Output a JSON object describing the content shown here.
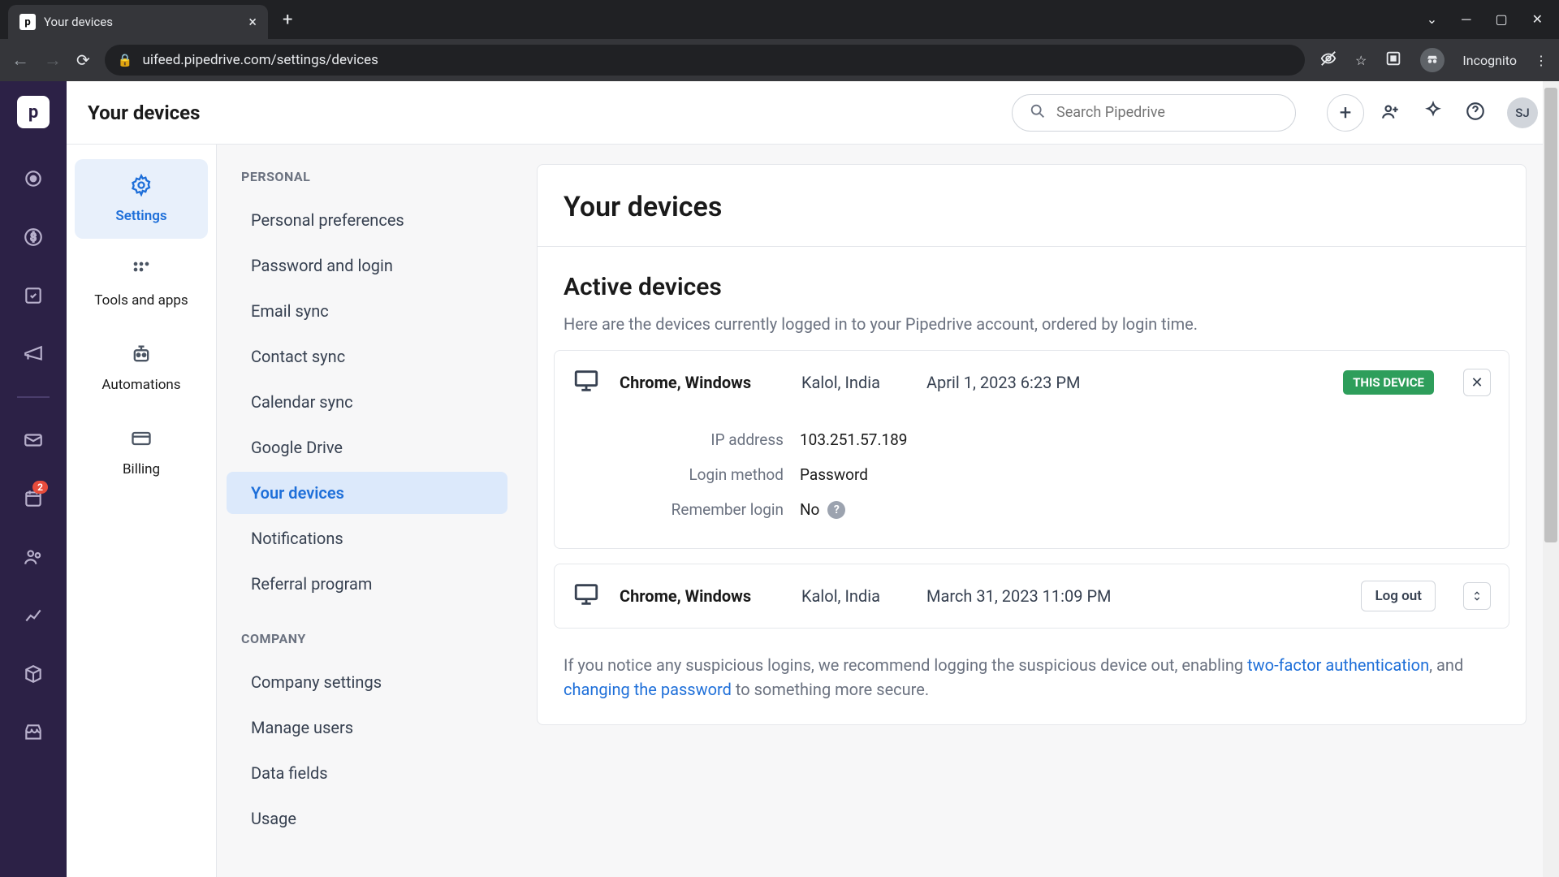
{
  "browser": {
    "tab_title": "Your devices",
    "url": "uifeed.pipedrive.com/settings/devices",
    "incognito_label": "Incognito"
  },
  "header": {
    "title": "Your devices",
    "search_placeholder": "Search Pipedrive",
    "avatar": "SJ"
  },
  "rail": {
    "badge_count": "2"
  },
  "settings_tabs": [
    {
      "label": "Settings",
      "icon": "gear",
      "active": true
    },
    {
      "label": "Tools and apps",
      "icon": "grid",
      "active": false
    },
    {
      "label": "Automations",
      "icon": "robot",
      "active": false
    },
    {
      "label": "Billing",
      "icon": "card",
      "active": false
    }
  ],
  "menu": {
    "personal_heading": "PERSONAL",
    "company_heading": "COMPANY",
    "personal": [
      "Personal preferences",
      "Password and login",
      "Email sync",
      "Contact sync",
      "Calendar sync",
      "Google Drive",
      "Your devices",
      "Notifications",
      "Referral program"
    ],
    "personal_active_index": 6,
    "company": [
      "Company settings",
      "Manage users",
      "Data fields",
      "Usage"
    ]
  },
  "panel": {
    "title": "Your devices",
    "active_heading": "Active devices",
    "active_desc": "Here are the devices currently logged in to your Pipedrive account, ordered by login time.",
    "this_device_badge": "THIS DEVICE",
    "logout_label": "Log out",
    "devices": [
      {
        "name": "Chrome, Windows",
        "location": "Kalol, India",
        "time": "April 1, 2023 6:23 PM",
        "this_device": true,
        "expanded": true,
        "details": {
          "ip_label": "IP address",
          "ip": "103.251.57.189",
          "login_method_label": "Login method",
          "login_method": "Password",
          "remember_label": "Remember login",
          "remember": "No"
        }
      },
      {
        "name": "Chrome, Windows",
        "location": "Kalol, India",
        "time": "March 31, 2023 11:09 PM",
        "this_device": false,
        "expanded": false
      }
    ],
    "notice_prefix": "If you notice any suspicious logins, we recommend logging the suspicious device out, enabling ",
    "notice_link1": "two-factor authentication",
    "notice_mid": ", and ",
    "notice_link2": "changing the password",
    "notice_suffix": " to something more secure."
  }
}
